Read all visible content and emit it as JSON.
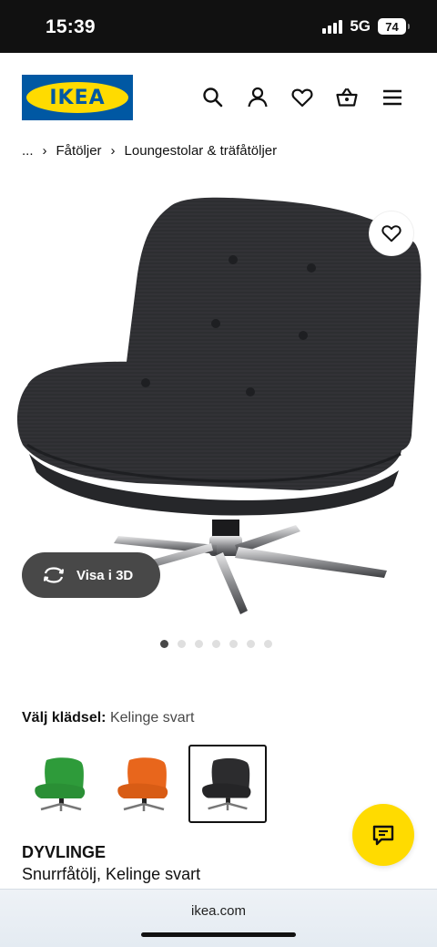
{
  "status": {
    "time": "15:39",
    "network": "5G",
    "battery": "74"
  },
  "header": {
    "logo_text": "IKEA"
  },
  "breadcrumb": {
    "ellipsis": "...",
    "items": [
      "Fåtöljer",
      "Loungestolar & träfåtöljer"
    ]
  },
  "gallery": {
    "view3d_label": "Visa i 3D",
    "dot_count": 7,
    "active_dot": 0
  },
  "upholstery": {
    "label": "Välj klädsel:",
    "selected": "Kelinge svart",
    "options": [
      {
        "color": "#2e9b3a",
        "selected": false
      },
      {
        "color": "#e8661c",
        "selected": false
      },
      {
        "color": "#2c2c2e",
        "selected": true
      }
    ]
  },
  "product": {
    "name": "DYVLINGE",
    "description": "Snurrfåtölj, Kelinge svart"
  },
  "browser": {
    "url": "ikea.com"
  },
  "colors": {
    "brand_blue": "#0058a3",
    "brand_yellow": "#ffdb00"
  }
}
